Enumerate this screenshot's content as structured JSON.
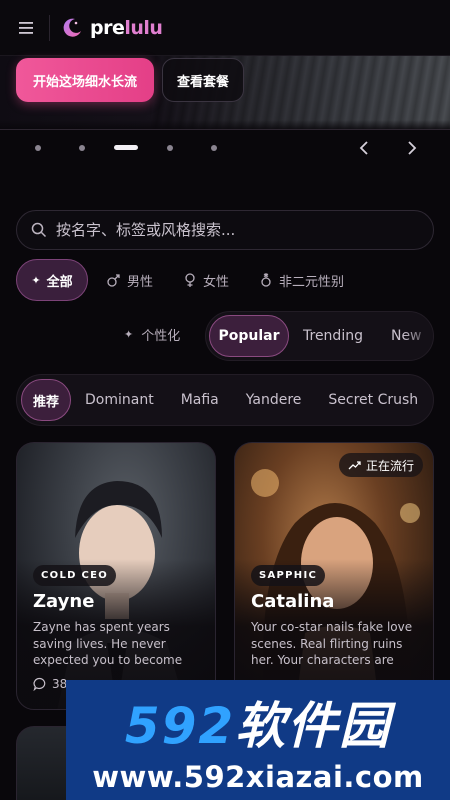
{
  "header": {
    "logo_pre": "pre",
    "logo_lulu": "lulu"
  },
  "hero": {
    "primary_cta": "开始这场细水长流",
    "secondary_cta": "查看套餐"
  },
  "carousel": {
    "count": 5,
    "active_index": 2
  },
  "search": {
    "placeholder": "按名字、标签或风格搜索..."
  },
  "gender_filter": {
    "all": "全部",
    "male": "男性",
    "female": "女性",
    "nonbinary": "非二元性别"
  },
  "sort": {
    "personalized": "个性化",
    "tabs": [
      "Popular",
      "Trending",
      "New"
    ],
    "active": "Popular"
  },
  "tags": {
    "active": "推荐",
    "items": [
      "Dominant",
      "Mafia",
      "Yandere",
      "Secret Crush"
    ]
  },
  "cards": [
    {
      "badge": "COLD CEO",
      "name": "Zayne",
      "description": "Zayne has spent years saving lives. He never expected you to become the habit he...",
      "stat": "38"
    },
    {
      "badge": "SAPPHIC",
      "name": "Catalina",
      "description": "Your co-star nails fake love scenes. Real flirting ruins her. Your characters are meant ...",
      "trending_label": "正在流行"
    }
  ],
  "watermark": {
    "top_num": "592",
    "top_text": "软件园",
    "bottom": "www.592xiazai.com"
  },
  "colors": {
    "accent_pink": "#f0589a",
    "active_chip": "#3c1f3c",
    "logo_lulu": "#e07fcf"
  }
}
